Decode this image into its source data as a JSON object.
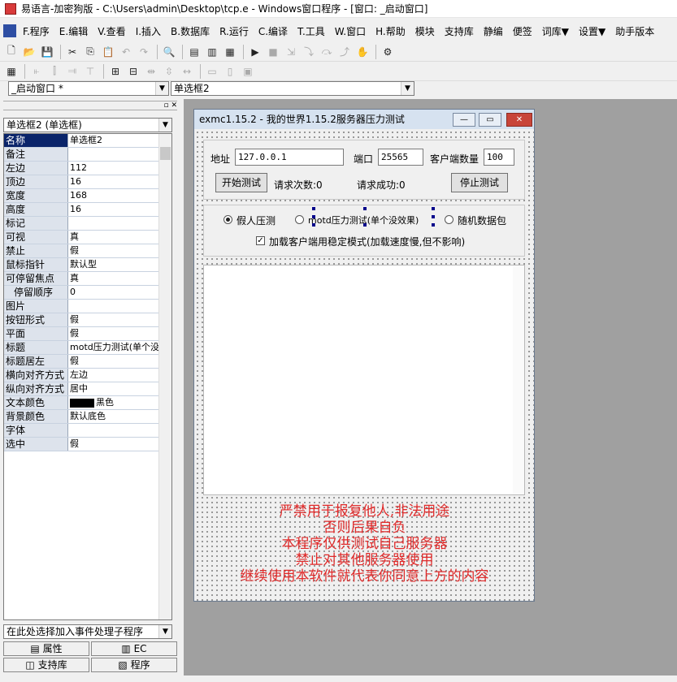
{
  "window": {
    "title": "易语言-加密狗版 - C:\\Users\\admin\\Desktop\\tcp.e - Windows窗口程序 - [窗口: _启动窗口]"
  },
  "menu": [
    "F.程序",
    "E.编辑",
    "V.查看",
    "I.插入",
    "B.数据库",
    "R.运行",
    "C.编译",
    "T.工具",
    "W.窗口",
    "H.帮助",
    "模块",
    "支持库",
    "静编",
    "便签",
    "词库▼",
    "设置▼",
    "助手版本"
  ],
  "toolbar1_icons": [
    "new-file-icon",
    "open-folder-icon",
    "save-icon",
    "cut-icon",
    "copy-icon",
    "paste-icon",
    "undo-icon",
    "redo-icon",
    "find-icon",
    "layout1-icon",
    "layout2-icon",
    "layout3-icon",
    "run-icon",
    "stop-icon",
    "step-icon",
    "step-into-icon",
    "step-over-icon",
    "step-out-icon",
    "pause-hand-icon",
    "debug-icon"
  ],
  "combos": {
    "window_select": "_启动窗口 *",
    "component_select": "单选框2"
  },
  "properties": {
    "header": "单选框2 (单选框)",
    "rows": [
      {
        "name": "名称",
        "value": "单选框2"
      },
      {
        "name": "备注",
        "value": ""
      },
      {
        "name": "左边",
        "value": "112"
      },
      {
        "name": "顶边",
        "value": "16"
      },
      {
        "name": "宽度",
        "value": "168"
      },
      {
        "name": "高度",
        "value": "16"
      },
      {
        "name": "标记",
        "value": ""
      },
      {
        "name": "可视",
        "value": "真"
      },
      {
        "name": "禁止",
        "value": "假"
      },
      {
        "name": "鼠标指针",
        "value": "默认型"
      },
      {
        "name": "可停留焦点",
        "value": "真"
      },
      {
        "name": "停留顺序",
        "value": "0"
      },
      {
        "name": "图片",
        "value": ""
      },
      {
        "name": "按钮形式",
        "value": "假"
      },
      {
        "name": "平面",
        "value": "假"
      },
      {
        "name": "标题",
        "value": "motd压力测试(单个没"
      },
      {
        "name": "标题居左",
        "value": "假"
      },
      {
        "name": "横向对齐方式",
        "value": "左边"
      },
      {
        "name": "纵向对齐方式",
        "value": "居中"
      },
      {
        "name": "文本颜色",
        "value": "黑色"
      },
      {
        "name": "背景颜色",
        "value": "默认底色"
      },
      {
        "name": "字体",
        "value": ""
      },
      {
        "name": "选中",
        "value": "假"
      }
    ],
    "event_select": "在此处选择加入事件处理子程序"
  },
  "tabs": {
    "props": "属性",
    "ec": "EC",
    "support": "支持库",
    "program": "程序"
  },
  "form": {
    "title": "exmc1.15.2 - 我的世界1.15.2服务器压力测试",
    "address_label": "地址",
    "address_value": "127.0.0.1",
    "port_label": "端口",
    "port_value": "25565",
    "clients_label": "客户端数量",
    "clients_value": "100",
    "start_button": "开始测试",
    "request_count": "请求次数:0",
    "request_success": "请求成功:0",
    "stop_button": "停止测试",
    "radio1": "假人压测",
    "radio2": "motd压力测试(单个没效果)",
    "radio3": "随机数据包",
    "checkbox_label": "加载客户端用稳定模式(加载速度慢,但不影响)",
    "warnings": [
      "严禁用于报复他人,非法用途",
      "否则后果自负",
      "本程序仅供测试自己服务器",
      "禁止对其他服务器使用",
      "继续使用本软件就代表你同意上方的内容"
    ]
  }
}
